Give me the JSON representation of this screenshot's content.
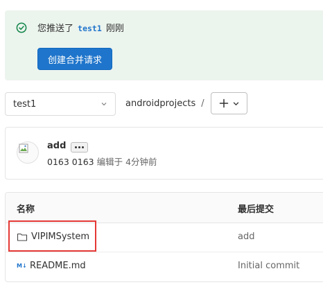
{
  "alert": {
    "text_before": "您推送了",
    "branch": "test1",
    "text_after": "刚刚",
    "button_label": "创建合并请求",
    "success_color": "#108548"
  },
  "repo_nav": {
    "branch": "test1",
    "path_root": "androidprojects",
    "path_sep": "/",
    "add_icon": "plus-icon"
  },
  "commit": {
    "title": "add",
    "author": "0163 0163",
    "action": "编辑于",
    "time": "4分钟前"
  },
  "table": {
    "headers": {
      "name": "名称",
      "last_commit": "最后提交"
    },
    "rows": [
      {
        "icon": "folder-icon",
        "name": "VIPIMSystem",
        "commit": "add"
      },
      {
        "icon": "markdown-icon",
        "icon_text": "M↓",
        "name": "README.md",
        "commit": "Initial commit"
      }
    ]
  }
}
